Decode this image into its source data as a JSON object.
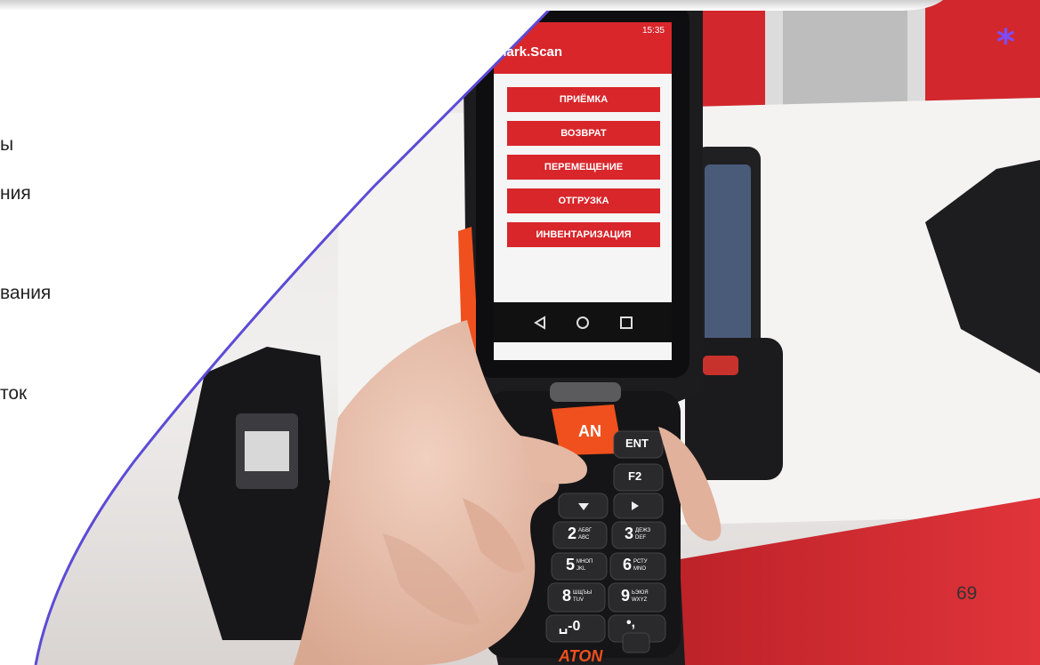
{
  "slide": {
    "bullet_fragments": [
      "ы",
      "ния",
      "вания",
      "ток"
    ],
    "page_number": "69",
    "corner_mark": "*"
  },
  "device": {
    "status_time": "15:35",
    "app_title": "Mark.Scan",
    "menu": [
      "ПРИЁМКА",
      "ВОЗВРАТ",
      "ПЕРЕМЕЩЕНИЕ",
      "ОТГРУЗКА",
      "ИНВЕНТАРИЗАЦИЯ"
    ],
    "scan_key": "AN",
    "keys": {
      "ent": "ENT",
      "f2": "F2",
      "k2": "2",
      "k2_sub_top": "АБВГ",
      "k2_sub_bot": "ABC",
      "k3": "3",
      "k3_sub_top": "ДЕЖЗ",
      "k3_sub_bot": "DEF",
      "k5": "5",
      "k5_sub_top": "МНОП",
      "k5_sub_bot": "JKL",
      "k6": "6",
      "k6_sub_top": "РСТУ",
      "k6_sub_bot": "MNO",
      "k8": "8",
      "k8_sub_top": "ШЩЪЫ",
      "k8_sub_bot": "TUV",
      "k9": "9",
      "k9_sub_top": "ЬЭЮЯ",
      "k9_sub_bot": "WXYZ",
      "k0": "␣-0",
      "kdot": "•,"
    },
    "brand": "ATON",
    "colors": {
      "app_red": "#d8262b",
      "body": "#1c1c1e",
      "accent_orange": "#f0501e",
      "frame_line": "#5b4bd6"
    }
  }
}
